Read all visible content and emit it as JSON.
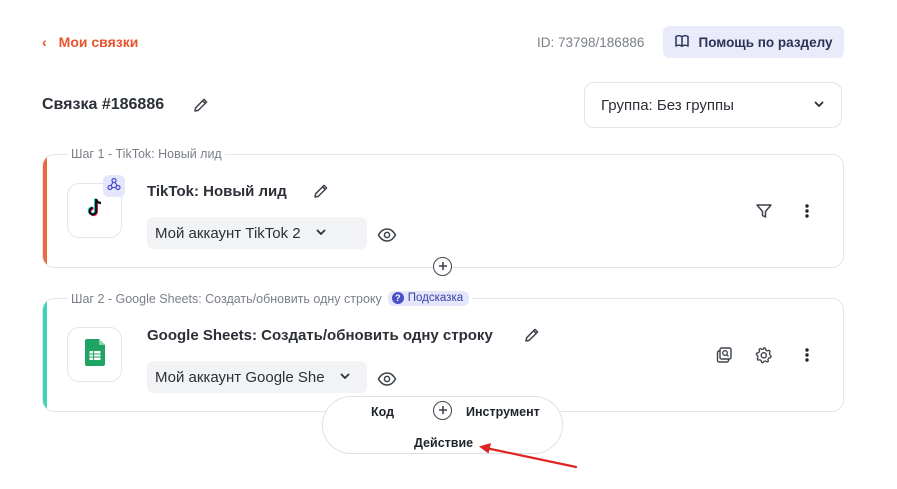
{
  "header": {
    "back_label": "Мои связки",
    "id_label": "ID: 73798/186886",
    "help_label": "Помощь по разделу"
  },
  "bundle": {
    "title": "Связка #186886",
    "group_label": "Группа: Без группы"
  },
  "steps": [
    {
      "label": "Шаг 1 - TikTok: Новый лид",
      "title": "TikTok: Новый лид",
      "account": "Мой аккаунт TikTok 2",
      "stripe_color": "#ea6a3c"
    },
    {
      "label": "Шаг 2 - Google Sheets: Создать/обновить одну строку",
      "hint": "Подсказка",
      "title": "Google Sheets: Создать/обновить одну строку",
      "account": "Мой аккаунт Google She",
      "stripe_color": "#3ed2b6"
    }
  ],
  "add_menu": {
    "code": "Код",
    "tool": "Инструмент",
    "action": "Действие"
  },
  "colors": {
    "accent": "#e8542c",
    "arrow": "#e02424",
    "sheets_green": "#1fa463"
  }
}
